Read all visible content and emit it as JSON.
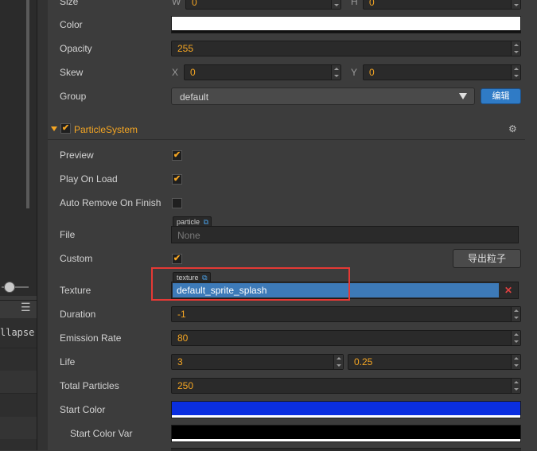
{
  "left_panel": {
    "collapse_text": "llapse"
  },
  "size": {
    "label": "Size",
    "w_label": "W",
    "w_value": "0",
    "h_label": "H",
    "h_value": "0"
  },
  "color": {
    "label": "Color",
    "swatch": "#ffffff"
  },
  "opacity": {
    "label": "Opacity",
    "value": "255"
  },
  "skew": {
    "label": "Skew",
    "x_label": "X",
    "x_value": "0",
    "y_label": "Y",
    "y_value": "0"
  },
  "group": {
    "label": "Group",
    "value": "default",
    "edit_button": "编辑"
  },
  "particle_system": {
    "title": "ParticleSystem",
    "enabled": true,
    "preview": {
      "label": "Preview",
      "checked": true
    },
    "play_on_load": {
      "label": "Play On Load",
      "checked": true
    },
    "auto_remove": {
      "label": "Auto Remove On Finish",
      "checked": false
    },
    "file": {
      "label": "File",
      "tag": "particle",
      "value": "None"
    },
    "custom": {
      "label": "Custom",
      "checked": true,
      "export_button": "导出粒子"
    },
    "texture": {
      "label": "Texture",
      "tag": "texture",
      "value": "default_sprite_splash",
      "clear": "✕"
    },
    "duration": {
      "label": "Duration",
      "value": "-1"
    },
    "emission_rate": {
      "label": "Emission Rate",
      "value": "80"
    },
    "life": {
      "label": "Life",
      "value": "3",
      "var": "0.25"
    },
    "total_particles": {
      "label": "Total Particles",
      "value": "250"
    },
    "start_color": {
      "label": "Start Color",
      "swatch": "#0a2ee0"
    },
    "start_color_var": {
      "label": "Start Color Var",
      "swatch": "#000000"
    }
  },
  "colors": {
    "accent": "#f5a623",
    "highlight_box": "#e53935",
    "selected_field": "#3d7ab8",
    "button_blue": "#2f7bc6"
  }
}
